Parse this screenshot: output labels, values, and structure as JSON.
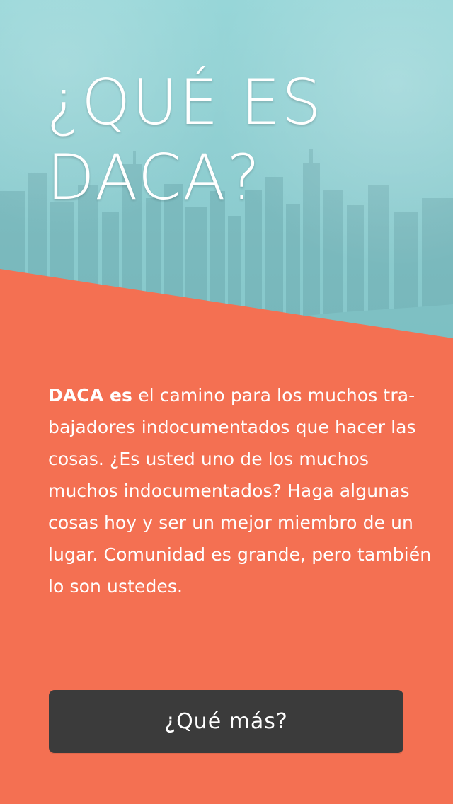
{
  "theme": {
    "hero_tint": "#8fced1",
    "accent_orange": "#f47052",
    "button_bg": "#3b3b3b",
    "text_color": "#ffffff"
  },
  "hero": {
    "title_line_1": "¿QUÉ ES",
    "title_line_2": "DACA?"
  },
  "body": {
    "line_1_bold": "DACA es",
    "line_1_rest": " el camino para los muchos tra-",
    "line_2": "bajadores indocumentados que hacer las",
    "line_3": "cosas. ¿Es usted uno de los muchos",
    "line_4": "muchos indocumentados? Haga algunas",
    "line_5": "cosas hoy y ser un mejor miembro de un",
    "line_6": "lugar. Comunidad es grande, pero también",
    "line_7": "lo son ustedes."
  },
  "cta": {
    "label": "¿Qué más?"
  }
}
